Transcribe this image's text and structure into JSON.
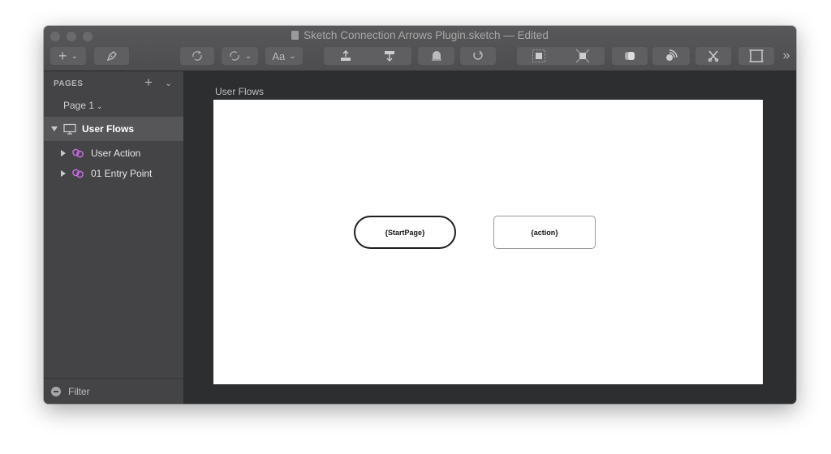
{
  "window": {
    "title": "Sketch Connection Arrows Plugin.sketch",
    "title_suffix": " — Edited"
  },
  "toolbar": {
    "insert_icon": "plus-icon",
    "edit_icon": "pen-nib-icon",
    "rotate_icon": "rotate-icon",
    "transform_icon": "transform-icon",
    "text_label": "Aa",
    "forward_icon": "bring-forward-icon",
    "backward_icon": "send-backward-icon",
    "mask_icon": "mask-icon",
    "flatten_icon": "flatten-icon",
    "overflow_label": "»"
  },
  "sidebar": {
    "pages_label": "PAGES",
    "add_icon": "plus-icon",
    "current_page": "Page 1",
    "layers": [
      {
        "label": "User Flows",
        "icon": "artboard-icon",
        "expanded": true
      },
      {
        "label": "User Action",
        "icon": "symbol-icon"
      },
      {
        "label": "01 Entry Point",
        "icon": "symbol-icon"
      }
    ],
    "filter_label": "Filter"
  },
  "canvas": {
    "artboard_label": "User Flows",
    "nodes": [
      {
        "label": "{StartPage}"
      },
      {
        "label": "{action}"
      }
    ]
  },
  "colors": {
    "symbol_accent": "#c56be0",
    "canvas_bg": "#2c2e30",
    "artboard_bg": "#ffffff"
  }
}
